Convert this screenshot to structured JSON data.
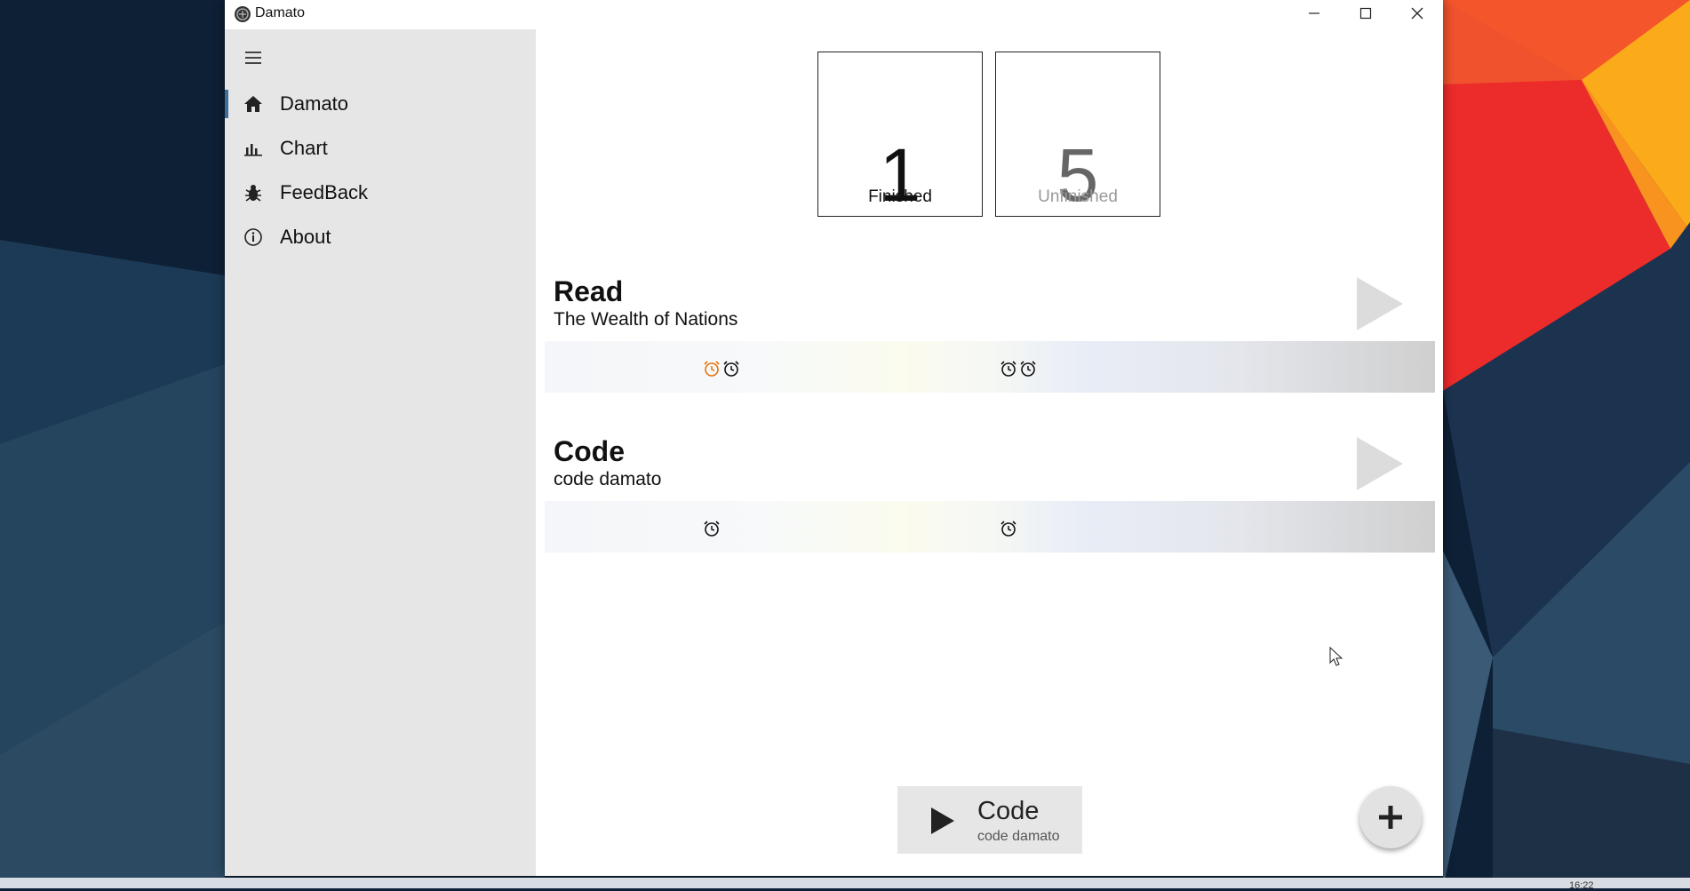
{
  "window": {
    "title": "Damato",
    "controls": {
      "minimize": "minimize",
      "maximize": "maximize",
      "close": "close"
    }
  },
  "sidebar": {
    "items": [
      {
        "label": "Damato",
        "icon": "home-icon",
        "active": true
      },
      {
        "label": "Chart",
        "icon": "chart-icon",
        "active": false
      },
      {
        "label": "FeedBack",
        "icon": "bug-icon",
        "active": false
      },
      {
        "label": "About",
        "icon": "info-icon",
        "active": false
      }
    ]
  },
  "stats": {
    "finished": {
      "count": "1",
      "label": "Finished"
    },
    "unfinished": {
      "count": "5",
      "label": "Unfinished"
    }
  },
  "tasks": [
    {
      "title": "Read",
      "subtitle": "The Wealth of Nations",
      "alarms_left": [
        "active",
        "normal"
      ],
      "alarms_right": [
        "normal",
        "normal"
      ]
    },
    {
      "title": "Code",
      "subtitle": "code damato",
      "alarms_left": [
        "normal"
      ],
      "alarms_right": [
        "normal"
      ]
    }
  ],
  "current_task": {
    "title": "Code",
    "subtitle": "code damato"
  },
  "taskbar": {
    "time": "16:22"
  },
  "colors": {
    "accent": "#3d6e9c",
    "alarm_active": "#e8730c",
    "sidebar_bg": "#e6e6e6"
  }
}
